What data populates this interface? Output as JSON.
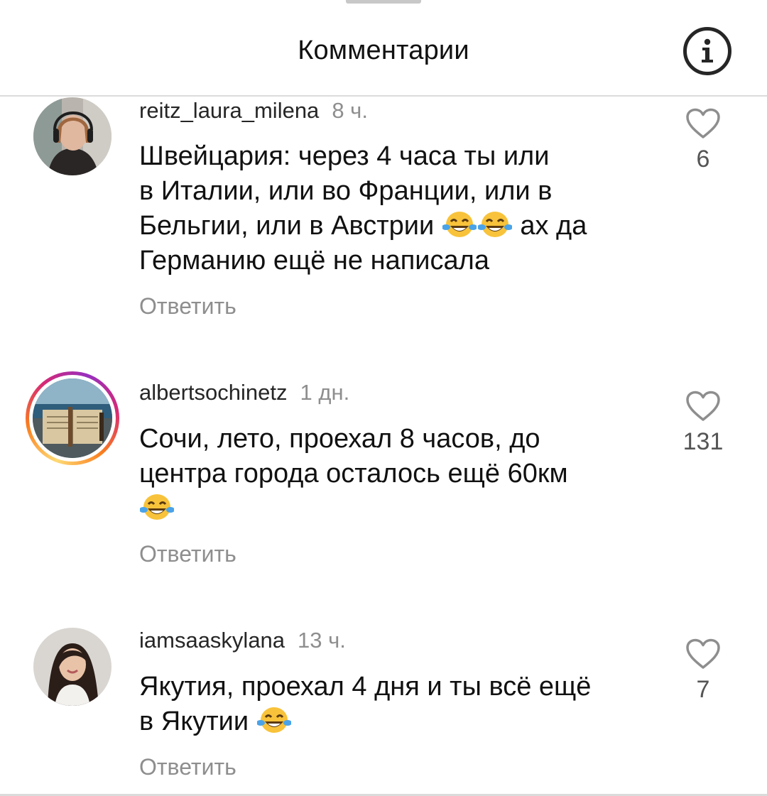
{
  "header": {
    "title": "Комментарии",
    "info_icon": "info-icon"
  },
  "comments": [
    {
      "username": "reitz_laura_milena",
      "time": "8 ч.",
      "text_lines": [
        "Швейцария: через 4 часа ты или",
        "в Италии, или во Франции, или в",
        "Бельгии, или в Австрии",
        " ах да",
        "Германию ещё не написала"
      ],
      "emoji": "😂😂",
      "reply_label": "Ответить",
      "likes": "6"
    },
    {
      "username": "albertsochinetz",
      "time": "1 дн.",
      "text_lines": [
        "Сочи, лето, проехал 8 часов, до",
        "центра города осталось ещё 60км"
      ],
      "emoji": "😂",
      "reply_label": "Ответить",
      "likes": "131",
      "has_story": true
    },
    {
      "username": "iamsaaskylana",
      "time": "13 ч.",
      "text_lines": [
        "Якутия, проехал 4 дня и ты всё ещё",
        "в Якутии"
      ],
      "emoji": "😂",
      "reply_label": "Ответить",
      "likes": "7"
    }
  ]
}
